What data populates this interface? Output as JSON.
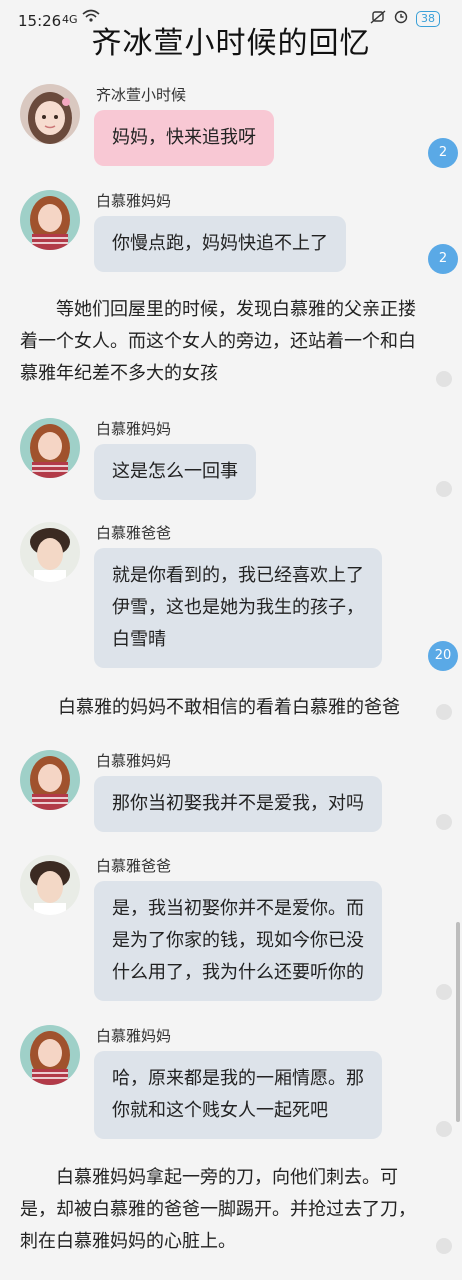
{
  "status": {
    "time": "15:26",
    "signal": "4G",
    "battery": "38"
  },
  "title": "齐冰萱小时候的回忆",
  "messages": [
    {
      "name": "齐冰萱小时候",
      "text": "妈妈，快来追我呀"
    },
    {
      "name": "白慕雅妈妈",
      "text": "你慢点跑，妈妈快追不上了"
    },
    {
      "name": "白慕雅妈妈",
      "text": "这是怎么一回事"
    },
    {
      "name": "白慕雅爸爸",
      "lines": [
        "就是你看到的，我已经喜欢上了",
        "伊雪，这也是她为我生的孩子，",
        "白雪晴"
      ]
    },
    {
      "name": "白慕雅妈妈",
      "text": "那你当初娶我并不是爱我，对吗"
    },
    {
      "name": "白慕雅爸爸",
      "lines": [
        "是，我当初娶你并不是爱你。而",
        "是为了你家的钱，现如今你已没",
        "什么用了，我为什么还要听你的"
      ]
    },
    {
      "name": "白慕雅妈妈",
      "lines": [
        "哈，原来都是我的一厢情愿。那",
        "你就和这个贱女人一起死吧"
      ]
    }
  ],
  "narrations": [
    "等她们回屋里的时候，发现白慕雅的父亲正搂着一个女人。而这个女人的旁边，还站着一个和白慕雅年纪差不多大的女孩",
    "白慕雅的妈妈不敢相信的看着白慕雅的爸爸",
    "白慕雅妈妈拿起一旁的刀，向他们刺去。可是，却被白慕雅的爸爸一脚踢开。并抢过去了刀，刺在白慕雅妈妈的心脏上。"
  ],
  "counters": [
    "2",
    "2",
    "20"
  ],
  "icons": {
    "avatar_child": "girl-avatar-icon",
    "avatar_mom": "mom-avatar-icon",
    "avatar_dad": "dad-avatar-icon"
  }
}
